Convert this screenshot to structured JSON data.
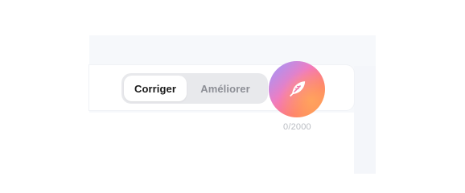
{
  "mode_toggle": {
    "options": [
      {
        "label": "Corriger",
        "state": "active"
      },
      {
        "label": "Améliorer",
        "state": "inactive"
      }
    ]
  },
  "send_button": {
    "icon": "feather-icon",
    "gradient_colors": [
      "#b98cf7",
      "#f27cc0",
      "#ff7a70",
      "#ff9a4a"
    ]
  },
  "char_counter": {
    "text": "0/2000"
  },
  "colors": {
    "panel_bg": "#f6f8fb",
    "toggle_bg": "#e8e9ec",
    "active_text": "#1a1a1a",
    "inactive_text": "#8d8f96",
    "counter_text": "#b9bcc2"
  }
}
